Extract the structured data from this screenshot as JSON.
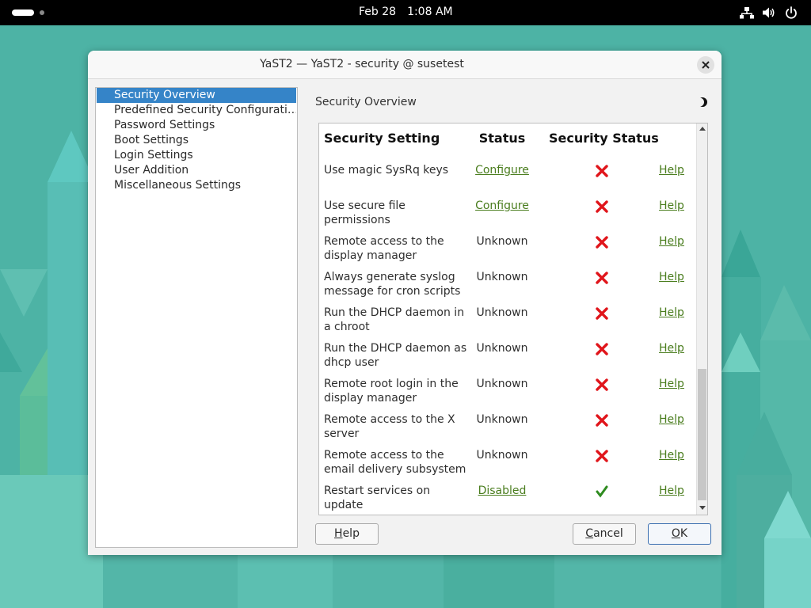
{
  "topbar": {
    "date": "Feb 28",
    "time": "1:08 AM",
    "icons": [
      "activities-indicator",
      "network-icon",
      "volume-icon",
      "power-icon"
    ]
  },
  "dialog": {
    "title": "YaST2 — YaST2 - security @ susetest",
    "close_icon": "close-icon"
  },
  "tree": {
    "items": [
      {
        "label": "Security Overview",
        "selected": true
      },
      {
        "label": "Predefined Security Configurati…",
        "selected": false
      },
      {
        "label": "Password Settings",
        "selected": false
      },
      {
        "label": "Boot Settings",
        "selected": false
      },
      {
        "label": "Login Settings",
        "selected": false
      },
      {
        "label": "User Addition",
        "selected": false
      },
      {
        "label": "Miscellaneous Settings",
        "selected": false
      }
    ]
  },
  "content": {
    "title": "Security Overview",
    "theme_icon": "moon-icon"
  },
  "table": {
    "headers": [
      "Security Setting",
      "Status",
      "Security Status"
    ],
    "rows": [
      {
        "setting": "Use magic SysRq keys",
        "status": "Configure",
        "status_link": true,
        "secure": false,
        "help": "Help"
      },
      {
        "setting": "Use secure file permissions",
        "status": "Configure",
        "status_link": true,
        "secure": false,
        "help": "Help"
      },
      {
        "setting": "Remote access to the display manager",
        "status": "Unknown",
        "status_link": false,
        "secure": false,
        "help": "Help"
      },
      {
        "setting": "Always generate syslog message for cron scripts",
        "status": "Unknown",
        "status_link": false,
        "secure": false,
        "help": "Help"
      },
      {
        "setting": "Run the DHCP daemon in a chroot",
        "status": "Unknown",
        "status_link": false,
        "secure": false,
        "help": "Help"
      },
      {
        "setting": "Run the DHCP daemon as dhcp user",
        "status": "Unknown",
        "status_link": false,
        "secure": false,
        "help": "Help"
      },
      {
        "setting": "Remote root login in the display manager",
        "status": "Unknown",
        "status_link": false,
        "secure": false,
        "help": "Help"
      },
      {
        "setting": "Remote access to the X server",
        "status": "Unknown",
        "status_link": false,
        "secure": false,
        "help": "Help"
      },
      {
        "setting": "Remote access to the email delivery subsystem",
        "status": "Unknown",
        "status_link": false,
        "secure": false,
        "help": "Help"
      },
      {
        "setting": "Restart services on update",
        "status": "Disabled",
        "status_link": true,
        "secure": true,
        "help": "Help"
      }
    ],
    "icons": {
      "insecure": "cross-icon",
      "secure": "check-icon"
    },
    "colors": {
      "insecure": "#e0151b",
      "secure": "#2e8b1f",
      "link": "#4a7d1e"
    }
  },
  "buttons": {
    "help": {
      "label": "Help",
      "mnemonic": "H"
    },
    "cancel": {
      "label": "Cancel",
      "mnemonic": "C"
    },
    "ok": {
      "label": "OK",
      "mnemonic": "O"
    }
  },
  "colors": {
    "selection": "#3584c8",
    "desktop": "#4fb4a6"
  }
}
